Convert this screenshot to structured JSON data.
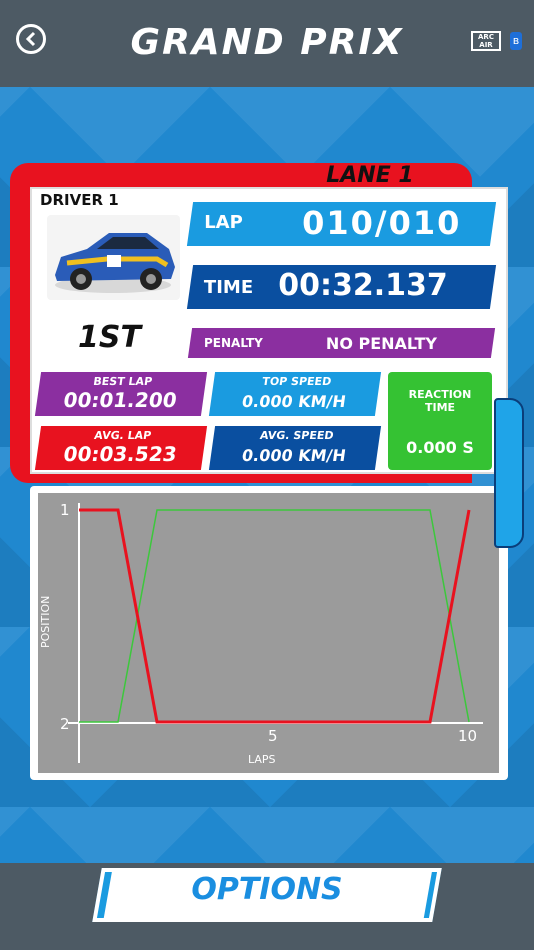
{
  "header": {
    "title": "GRAND PRIX",
    "logo_text_top": "ARC",
    "logo_text_bottom": "AIR",
    "bluetooth_icon": "bluetooth-icon",
    "back_icon": "chevron-left-icon"
  },
  "lane": {
    "label": "LANE 1",
    "driver": "DRIVER 1",
    "place": "1ST",
    "lap_label": "LAP",
    "lap_value": "010/010",
    "time_label": "TIME",
    "time_value": "00:32.137",
    "penalty_label": "PENALTY",
    "penalty_value": "NO PENALTY"
  },
  "stats": {
    "best_lap_label": "BEST   LAP",
    "best_lap_value": "00:01.200",
    "avg_lap_label": "AVG.   LAP",
    "avg_lap_value": "00:03.523",
    "top_speed_label": "TOP   SPEED",
    "top_speed_value": "0.000 KM/H",
    "avg_speed_label": "AVG.   SPEED",
    "avg_speed_value": "0.000 KM/H",
    "reaction_label_1": "REACTION",
    "reaction_label_2": "TIME",
    "reaction_value": "0.000 S"
  },
  "colors": {
    "lane_red": "#e8121f",
    "series_driver": "#e8121f",
    "series_other": "#3cc83c"
  },
  "footer": {
    "options_label": "OPTIONS"
  },
  "chart_data": {
    "type": "line",
    "xlabel": "LAPS",
    "ylabel": "POSITION",
    "x_ticks": [
      "5",
      "10"
    ],
    "y_ticks": [
      "1",
      "2"
    ],
    "xlim": [
      0,
      10
    ],
    "ylim": [
      2,
      1
    ],
    "series": [
      {
        "color": "#e8121f",
        "x": [
          0,
          1,
          2,
          9,
          10
        ],
        "y": [
          1,
          1,
          2,
          2,
          1
        ]
      },
      {
        "color": "#3cc83c",
        "x": [
          0,
          1,
          2,
          9,
          10
        ],
        "y": [
          2,
          2,
          1,
          1,
          2
        ]
      }
    ]
  }
}
